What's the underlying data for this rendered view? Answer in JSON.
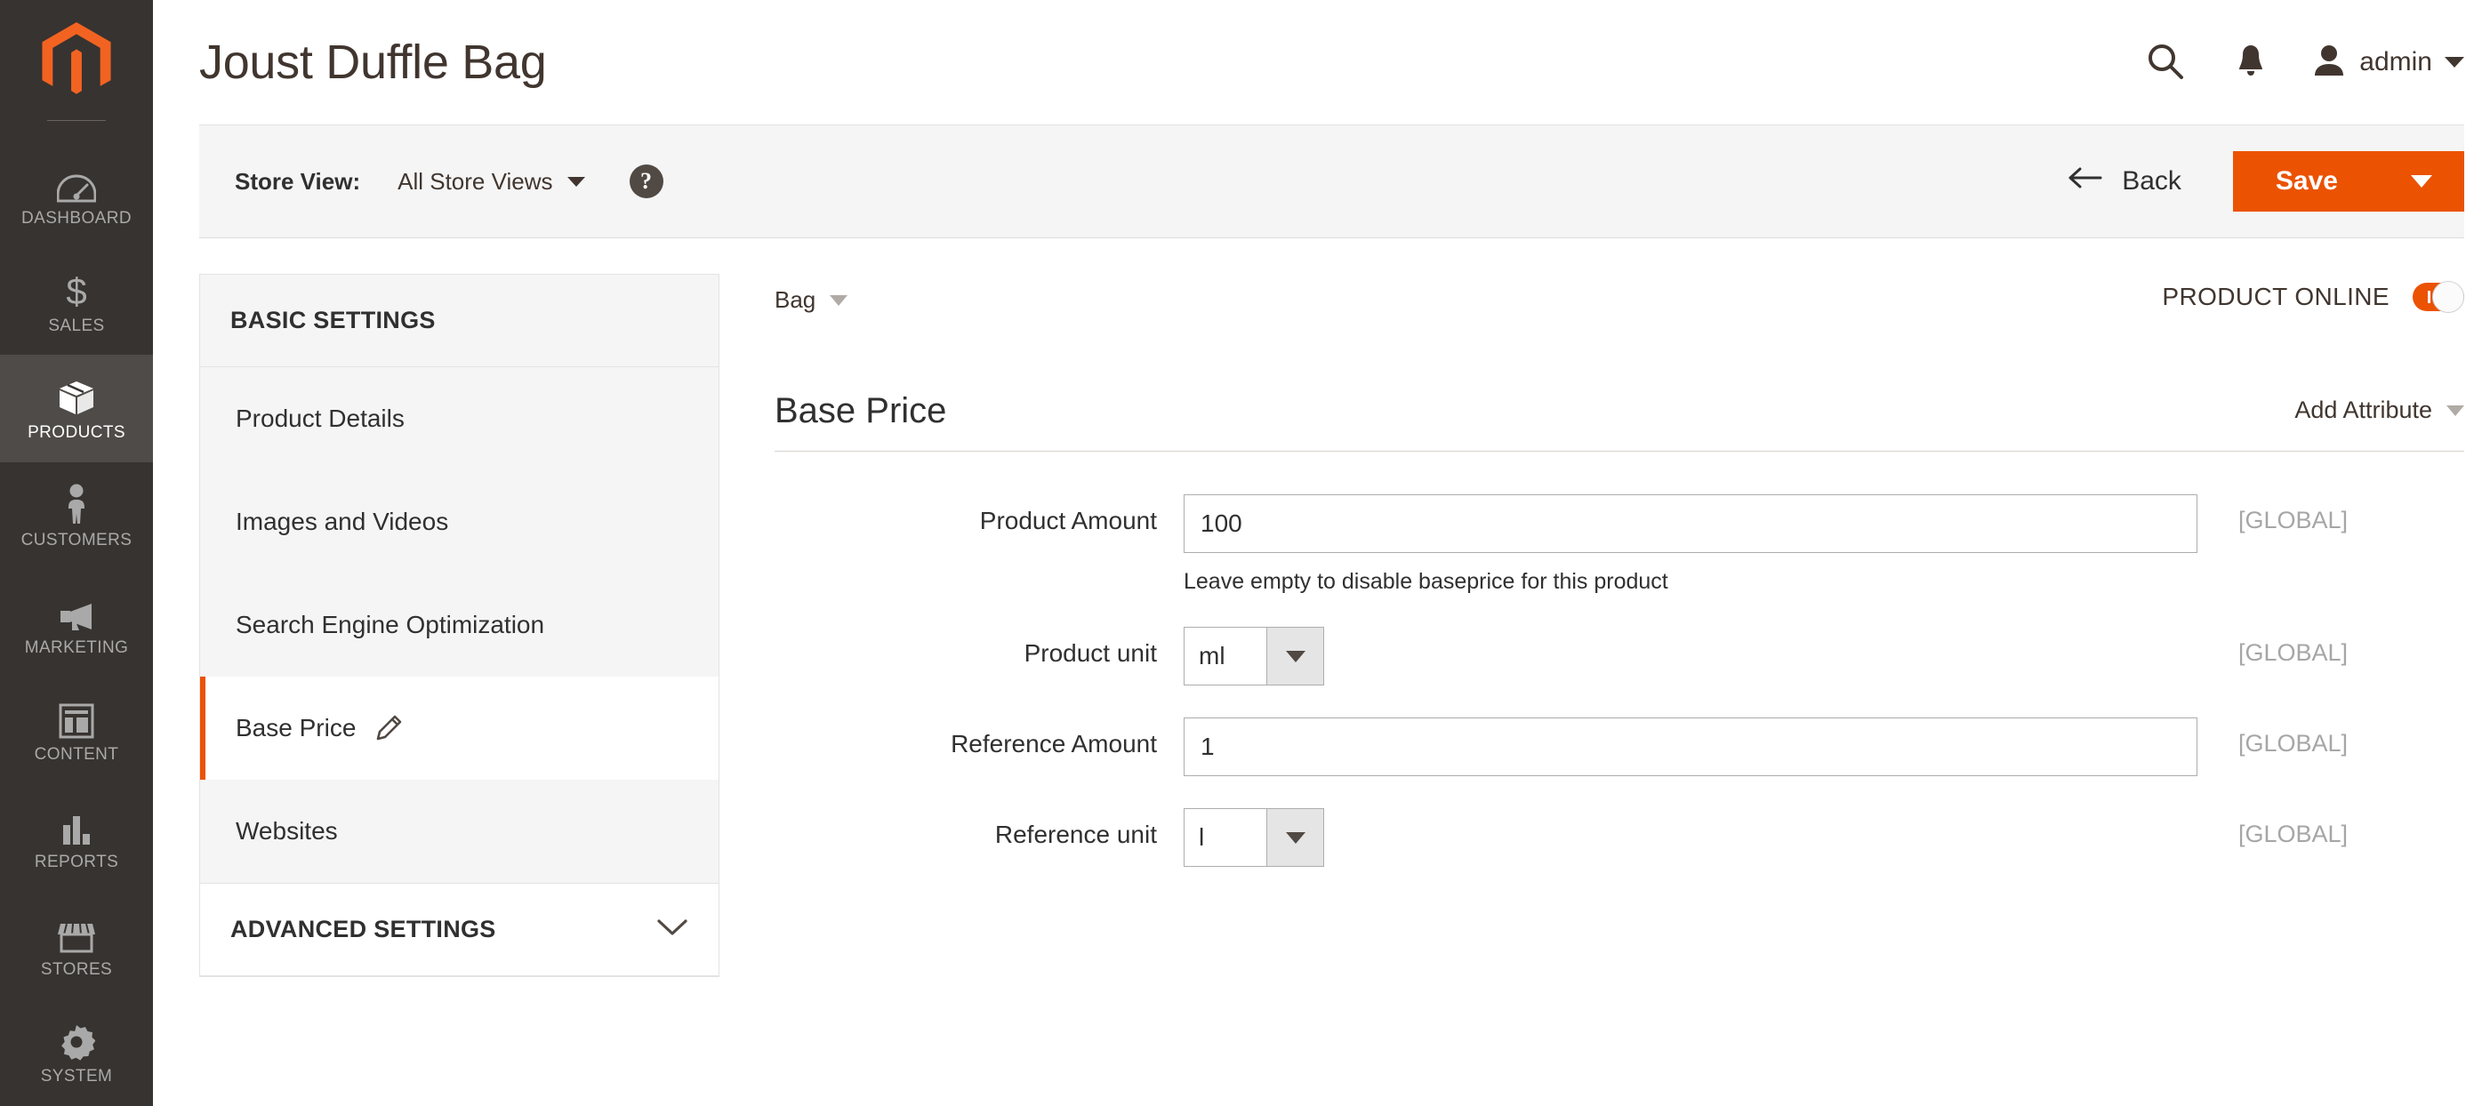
{
  "nav": {
    "logo_name": "magento-logo",
    "items": [
      {
        "label": "DASHBOARD",
        "icon": "dashboard-icon",
        "active": false
      },
      {
        "label": "SALES",
        "icon": "dollar-icon",
        "active": false
      },
      {
        "label": "PRODUCTS",
        "icon": "box-icon",
        "active": true
      },
      {
        "label": "CUSTOMERS",
        "icon": "person-icon",
        "active": false
      },
      {
        "label": "MARKETING",
        "icon": "megaphone-icon",
        "active": false
      },
      {
        "label": "CONTENT",
        "icon": "layout-icon",
        "active": false
      },
      {
        "label": "REPORTS",
        "icon": "bar-chart-icon",
        "active": false
      },
      {
        "label": "STORES",
        "icon": "storefront-icon",
        "active": false
      },
      {
        "label": "SYSTEM",
        "icon": "gear-icon",
        "active": false
      }
    ]
  },
  "header": {
    "title": "Joust Duffle Bag",
    "search_icon": "search-icon",
    "notification_icon": "bell-icon",
    "avatar_icon": "user-avatar-icon",
    "admin_name": "admin"
  },
  "toolbar": {
    "store_view_label": "Store View:",
    "store_view_value": "All Store Views",
    "help_glyph": "?",
    "back_label": "Back",
    "back_icon": "arrow-left-icon",
    "save_label": "Save"
  },
  "sections": {
    "basic_title": "BASIC SETTINGS",
    "items": [
      {
        "label": "Product Details",
        "current": false,
        "pencil": false
      },
      {
        "label": "Images and Videos",
        "current": false,
        "pencil": false
      },
      {
        "label": "Search Engine Optimization",
        "current": false,
        "pencil": false
      },
      {
        "label": "Base Price",
        "current": true,
        "pencil": true
      },
      {
        "label": "Websites",
        "current": false,
        "pencil": false
      }
    ],
    "advanced_title": "ADVANCED SETTINGS"
  },
  "content": {
    "breadcrumb_value": "Bag",
    "online_label": "PRODUCT ONLINE",
    "online_state": "on",
    "section_title": "Base Price",
    "add_attribute_label": "Add Attribute",
    "fields": [
      {
        "label": "Product Amount",
        "type": "text",
        "value": "100",
        "note": "Leave empty to disable baseprice for this product",
        "scope": "[GLOBAL]"
      },
      {
        "label": "Product unit",
        "type": "select",
        "value": "ml",
        "note": "",
        "scope": "[GLOBAL]"
      },
      {
        "label": "Reference Amount",
        "type": "text",
        "value": "1",
        "note": "",
        "scope": "[GLOBAL]"
      },
      {
        "label": "Reference unit",
        "type": "select",
        "value": "l",
        "note": "",
        "scope": "[GLOBAL]"
      }
    ]
  },
  "colors": {
    "accent": "#eb5202",
    "nav_bg": "#373330",
    "nav_active_bg": "#4f4b48",
    "panel_bg": "#f5f5f5"
  }
}
